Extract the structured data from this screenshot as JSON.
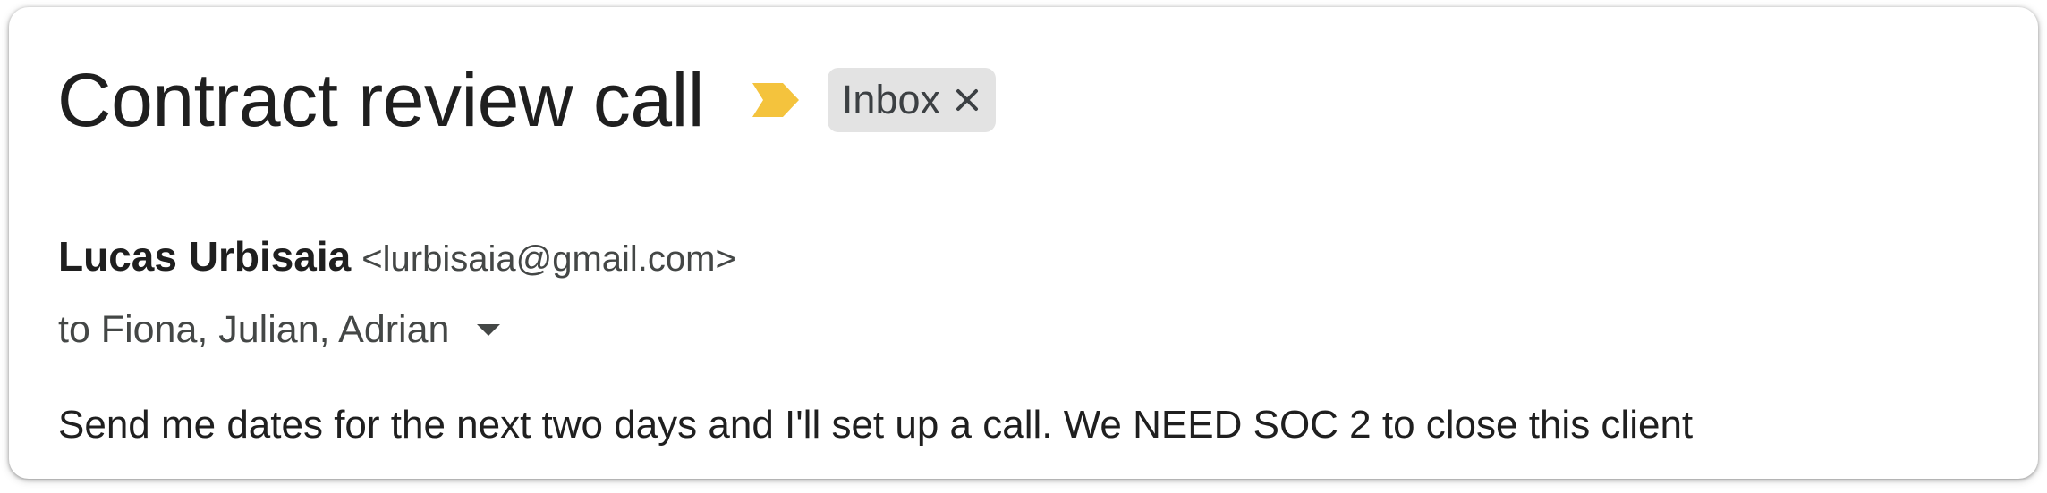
{
  "email": {
    "subject": "Contract review call",
    "importance_marker": {
      "icon": "importance-arrow-icon",
      "color": "#f4c33d"
    },
    "labels": [
      {
        "text": "Inbox",
        "remove_icon": "close-icon"
      }
    ],
    "sender": {
      "name": "Lucas Urbisaia",
      "email": "<lurbisaia@gmail.com>"
    },
    "recipients": "to Fiona, Julian, Adrian",
    "recipients_toggle_icon": "caret-down-icon",
    "body": "Send me dates for the next two days and I'll set up a call. We NEED SOC 2 to close this client"
  },
  "colors": {
    "text_primary": "#1f1f1f",
    "text_secondary": "#444746",
    "chip_background": "#e3e3e3",
    "importance": "#f4c33d"
  }
}
